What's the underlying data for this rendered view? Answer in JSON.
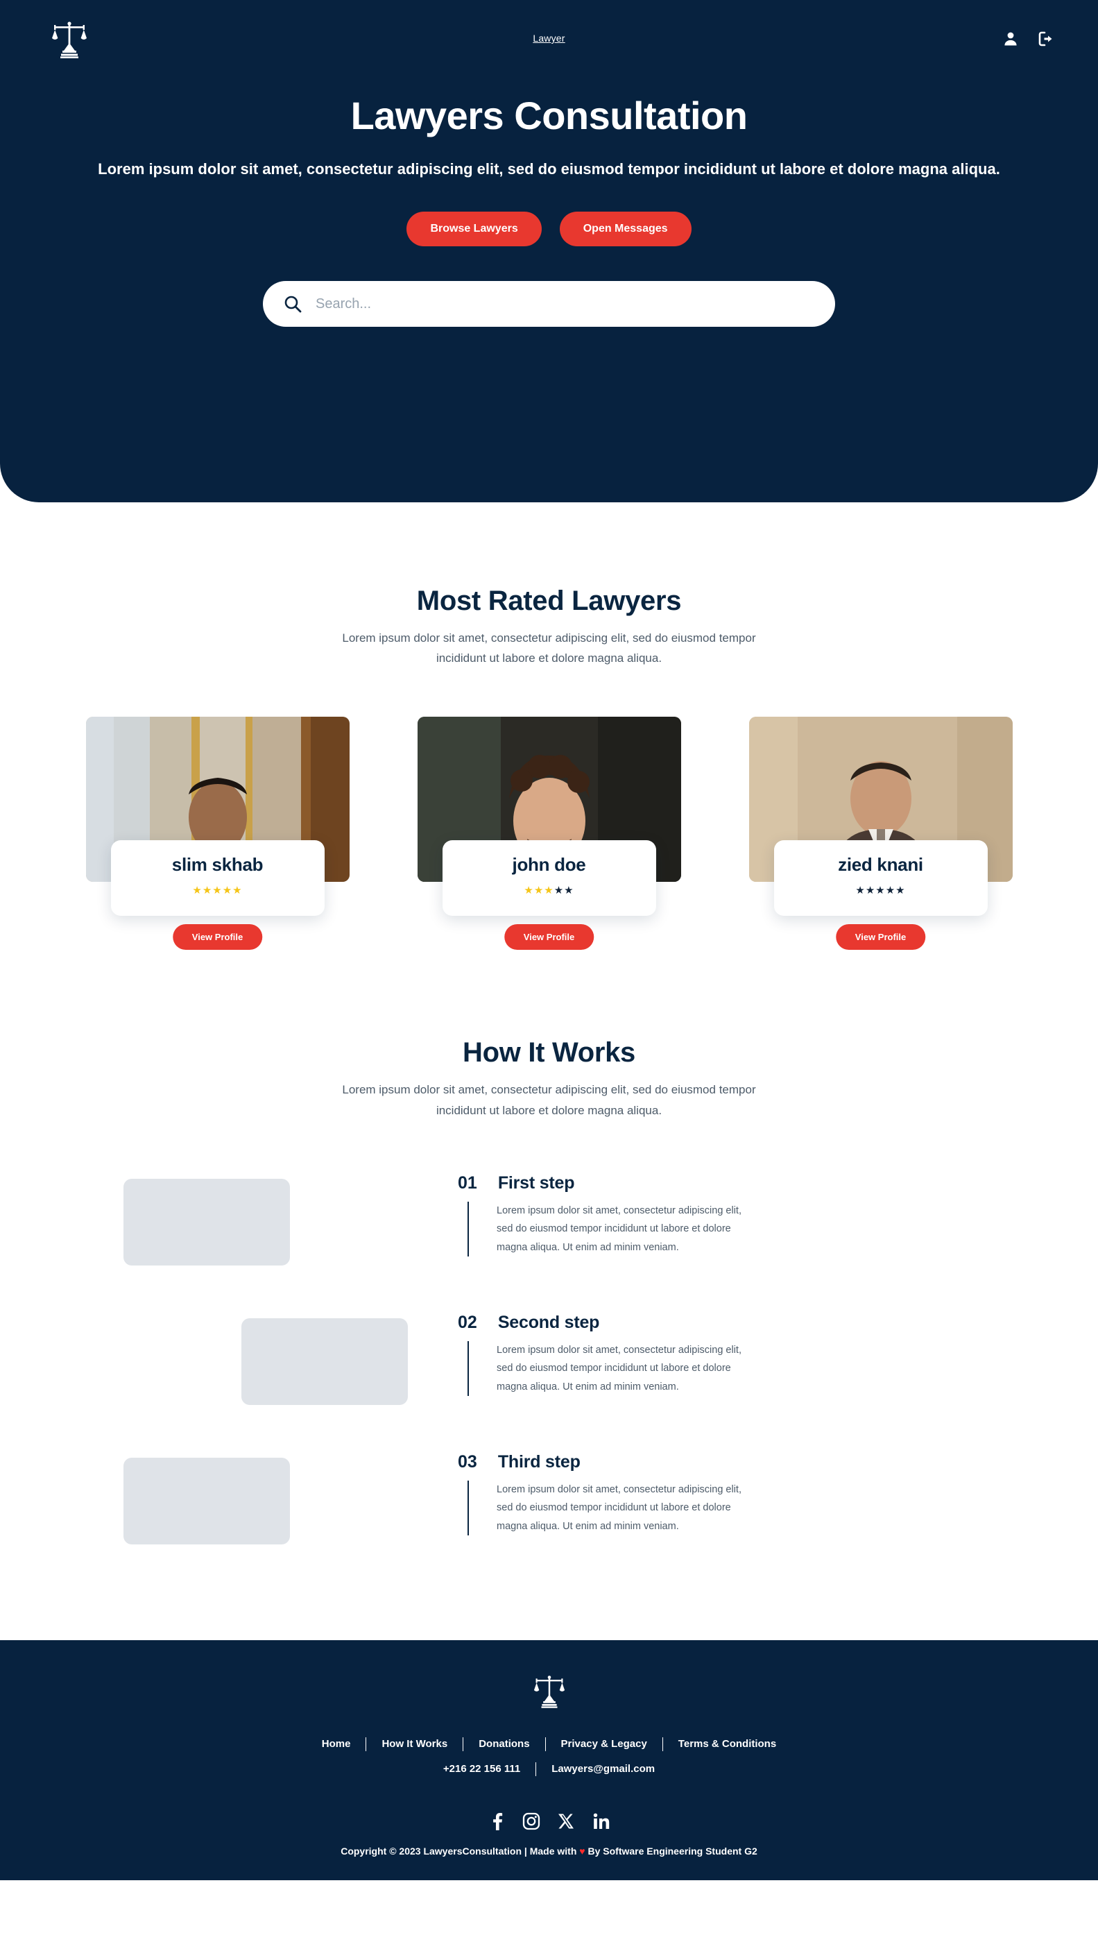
{
  "brand": {
    "logo_icon": "scales-of-justice-icon"
  },
  "navbar": {
    "link_label": "Lawyer",
    "profile_icon": "user-icon",
    "logout_icon": "logout-icon"
  },
  "hero": {
    "title": "Lawyers Consultation",
    "subtitle": "Lorem ipsum dolor sit amet, consectetur adipiscing elit, sed do eiusmod tempor incididunt ut labore et dolore magna aliqua.",
    "browse_button": "Browse Lawyers",
    "messages_button": "Open Messages",
    "search_placeholder": "Search...",
    "search_value": "",
    "search_icon": "search-icon"
  },
  "rated": {
    "title": "Most Rated Lawyers",
    "subtitle": "Lorem ipsum dolor sit amet, consectetur adipiscing elit, sed do eiusmod tempor incididunt ut labore et dolore magna aliqua.",
    "cards": [
      {
        "name": "slim skhab",
        "rating": 5,
        "max_rating": 5,
        "button": "View Profile"
      },
      {
        "name": "john doe",
        "rating": 3,
        "max_rating": 5,
        "button": "View Profile"
      },
      {
        "name": "zied knani",
        "rating": 0,
        "max_rating": 5,
        "button": "View Profile"
      }
    ]
  },
  "how": {
    "title": "How It Works",
    "subtitle": "Lorem ipsum dolor sit amet, consectetur adipiscing elit, sed do eiusmod tempor incididunt ut labore et dolore magna aliqua.",
    "steps": [
      {
        "num": "01",
        "title": "First step",
        "body": "Lorem ipsum dolor sit amet, consectetur adipiscing elit, sed do eiusmod tempor incididunt ut labore et dolore magna aliqua. Ut enim ad minim veniam."
      },
      {
        "num": "02",
        "title": "Second step",
        "body": "Lorem ipsum dolor sit amet, consectetur adipiscing elit, sed do eiusmod tempor incididunt ut labore et dolore magna aliqua. Ut enim ad minim veniam."
      },
      {
        "num": "03",
        "title": "Third step",
        "body": "Lorem ipsum dolor sit amet, consectetur adipiscing elit, sed do eiusmod tempor incididunt ut labore et dolore magna aliqua. Ut enim ad minim veniam."
      }
    ]
  },
  "footer": {
    "logo_icon": "scales-of-justice-icon",
    "links": [
      "Home",
      "How It Works",
      "Donations",
      "Privacy & Legacy",
      "Terms & Conditions"
    ],
    "phone": "+216 22 156 111",
    "email": "Lawyers@gmail.com",
    "socials": [
      "facebook-icon",
      "instagram-icon",
      "x-twitter-icon",
      "linkedin-icon"
    ],
    "copyright_before": "Copyright © 2023 LawyersConsultation | Made with ",
    "copyright_heart": "♥",
    "copyright_after": " By Software Engineering Student G2"
  },
  "colors": {
    "navy": "#07223f",
    "red": "#e8382f",
    "star_on": "#f5c518",
    "star_off": "#11243b",
    "placeholder_img": "#dfe3e8"
  }
}
